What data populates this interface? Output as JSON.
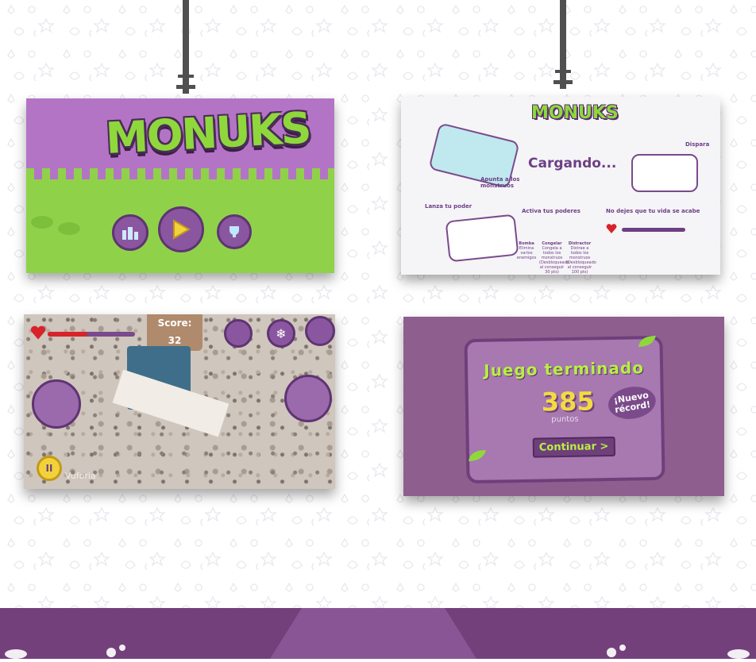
{
  "colors": {
    "purple": "#74407c",
    "green": "#8ed83c",
    "yellow": "#f2dc3e"
  },
  "screen1": {
    "logo": "MONUKS",
    "icons": [
      "ranking-icon",
      "play-icon",
      "trophy-icon"
    ]
  },
  "screen2": {
    "logo": "MONUKS",
    "loading": "Cargando...",
    "step1": "Apunta a los monstruos",
    "step2": "Dispara",
    "step3": "Activa tus poderes",
    "step4": "No dejes que tu vida se acabe",
    "lanza": "Lanza tu poder",
    "powers": [
      {
        "name": "Bomba",
        "desc": "Elimina varios enemigos"
      },
      {
        "name": "Congelar",
        "desc": "Congela a todos los monstruos (Desbloqueado al conseguir 30 pts)"
      },
      {
        "name": "Distractor",
        "desc": "Distrae a todos los monstruos (Desbloqueado al conseguir 100 pts)"
      }
    ]
  },
  "screen3": {
    "score_label": "Score:",
    "score_value": "32",
    "watermark": "Vuforia"
  },
  "screen4": {
    "title": "Juego terminado",
    "points": "385",
    "points_label": "puntos",
    "record": "¡Nuevo récord!",
    "continue_label": "Continuar >"
  }
}
